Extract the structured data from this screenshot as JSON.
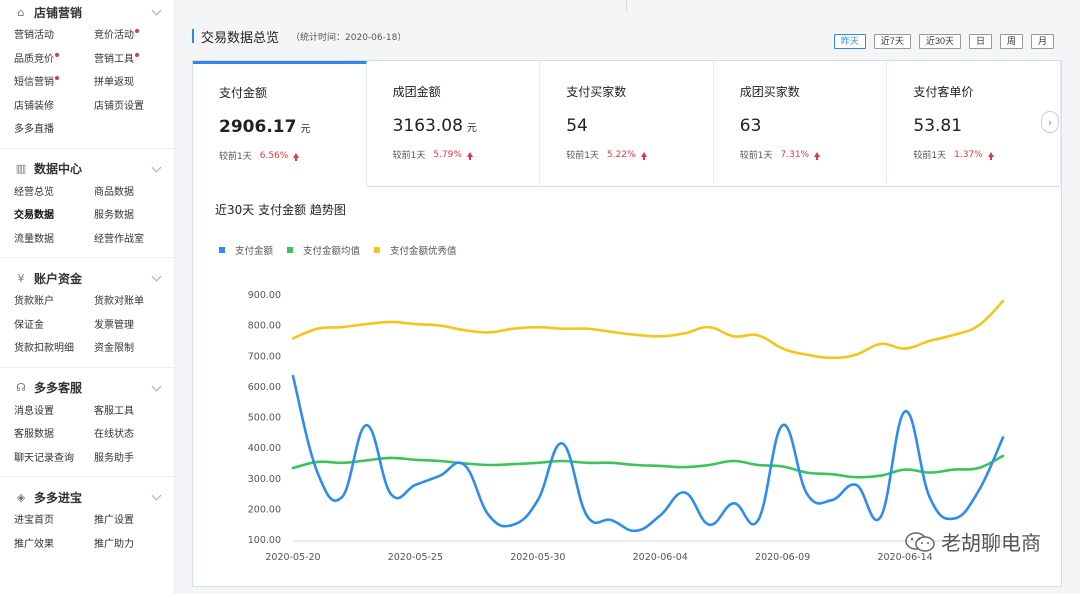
{
  "sidebar": {
    "sections": [
      {
        "title": "店铺营销",
        "icon": "shop-icon",
        "items": [
          {
            "label": "营销活动",
            "dot": false
          },
          {
            "label": "竞价活动",
            "dot": true
          },
          {
            "label": "品质竞价",
            "dot": true
          },
          {
            "label": "营销工具",
            "dot": true
          },
          {
            "label": "短信营销",
            "dot": true
          },
          {
            "label": "拼单返现",
            "dot": false
          },
          {
            "label": "店铺装修",
            "dot": false
          },
          {
            "label": "店铺页设置",
            "dot": false
          },
          {
            "label": "多多直播",
            "dot": false
          }
        ]
      },
      {
        "title": "数据中心",
        "icon": "bar-chart-icon",
        "items": [
          {
            "label": "经营总览",
            "dot": false
          },
          {
            "label": "商品数据",
            "dot": false
          },
          {
            "label": "交易数据",
            "dot": false,
            "active": true
          },
          {
            "label": "服务数据",
            "dot": false
          },
          {
            "label": "流量数据",
            "dot": false
          },
          {
            "label": "经营作战室",
            "dot": false
          }
        ]
      },
      {
        "title": "账户资金",
        "icon": "yen-icon",
        "items": [
          {
            "label": "货款账户",
            "dot": false
          },
          {
            "label": "货款对账单",
            "dot": false
          },
          {
            "label": "保证金",
            "dot": false
          },
          {
            "label": "发票管理",
            "dot": false
          },
          {
            "label": "货款扣款明细",
            "dot": false
          },
          {
            "label": "资金限制",
            "dot": false
          }
        ]
      },
      {
        "title": "多多客服",
        "icon": "headset-icon",
        "items": [
          {
            "label": "消息设置",
            "dot": false
          },
          {
            "label": "客服工具",
            "dot": false
          },
          {
            "label": "客服数据",
            "dot": false
          },
          {
            "label": "在线状态",
            "dot": false
          },
          {
            "label": "聊天记录查询",
            "dot": false
          },
          {
            "label": "服务助手",
            "dot": false
          }
        ]
      },
      {
        "title": "多多进宝",
        "icon": "treasure-icon",
        "items": [
          {
            "label": "进宝首页",
            "dot": false
          },
          {
            "label": "推广设置",
            "dot": false
          },
          {
            "label": "推广效果",
            "dot": false
          },
          {
            "label": "推广助力",
            "dot": false
          }
        ]
      }
    ]
  },
  "header": {
    "title": "交易数据总览",
    "subtitle": "（统计时间：2020-06-18）",
    "ranges": [
      {
        "label": "昨天",
        "active": true
      },
      {
        "label": "近7天",
        "active": false
      },
      {
        "label": "近30天",
        "active": false
      },
      {
        "label": "日",
        "active": false
      },
      {
        "label": "周",
        "active": false
      },
      {
        "label": "月",
        "active": false
      }
    ]
  },
  "cards": [
    {
      "title": "支付金额",
      "value": "2906.17",
      "unit": "元",
      "compare": "较前1天",
      "pct": "6.56%",
      "active": true
    },
    {
      "title": "成团金额",
      "value": "3163.08",
      "unit": "元",
      "compare": "较前1天",
      "pct": "5.79%",
      "active": false
    },
    {
      "title": "支付买家数",
      "value": "54",
      "unit": "",
      "compare": "较前1天",
      "pct": "5.22%",
      "active": false
    },
    {
      "title": "成团买家数",
      "value": "63",
      "unit": "",
      "compare": "较前1天",
      "pct": "7.31%",
      "active": false
    },
    {
      "title": "支付客单价",
      "value": "53.81",
      "unit": "",
      "compare": "较前1天",
      "pct": "1.37%",
      "active": false
    }
  ],
  "next_icon": "chevron-right-icon",
  "chart_title": "近30天 支付金额 趋势图",
  "watermark": "老胡聊电商",
  "chart_data": {
    "type": "line",
    "title": "近30天 支付金额 趋势图",
    "xlabel": "",
    "ylabel": "",
    "ylim": [
      100,
      900
    ],
    "yticks": [
      "100.00",
      "200.00",
      "300.00",
      "400.00",
      "500.00",
      "600.00",
      "700.00",
      "800.00",
      "900.00"
    ],
    "x": [
      "2020-05-20",
      "2020-05-21",
      "2020-05-22",
      "2020-05-23",
      "2020-05-24",
      "2020-05-25",
      "2020-05-26",
      "2020-05-27",
      "2020-05-28",
      "2020-05-29",
      "2020-05-30",
      "2020-05-31",
      "2020-06-01",
      "2020-06-02",
      "2020-06-03",
      "2020-06-04",
      "2020-06-05",
      "2020-06-06",
      "2020-06-07",
      "2020-06-08",
      "2020-06-09",
      "2020-06-10",
      "2020-06-11",
      "2020-06-12",
      "2020-06-13",
      "2020-06-14",
      "2020-06-15",
      "2020-06-16",
      "2020-06-17",
      "2020-06-18"
    ],
    "xticks": [
      "2020-05-20",
      "2020-05-25",
      "2020-05-30",
      "2020-06-04",
      "2020-06-09",
      "2020-06-14"
    ],
    "legend_position": "top-left",
    "grid": false,
    "series": [
      {
        "name": "支付金额",
        "color": "#2d8cf0",
        "values": [
          635,
          320,
          240,
          475,
          250,
          280,
          310,
          345,
          180,
          150,
          230,
          415,
          180,
          165,
          130,
          180,
          255,
          150,
          220,
          165,
          475,
          250,
          230,
          280,
          175,
          520,
          240,
          170,
          260,
          435
        ]
      },
      {
        "name": "支付金额均值",
        "color": "#3cc45a",
        "values": [
          335,
          355,
          352,
          360,
          368,
          362,
          358,
          350,
          345,
          348,
          352,
          358,
          352,
          352,
          345,
          342,
          338,
          345,
          358,
          345,
          340,
          320,
          315,
          305,
          310,
          330,
          320,
          330,
          335,
          375
        ]
      },
      {
        "name": "支付金额优秀值",
        "color": "#f5c518",
        "values": [
          758,
          790,
          795,
          805,
          812,
          805,
          800,
          785,
          778,
          790,
          795,
          790,
          790,
          780,
          770,
          765,
          775,
          795,
          765,
          768,
          725,
          705,
          695,
          705,
          740,
          725,
          750,
          770,
          800,
          880
        ]
      }
    ]
  }
}
